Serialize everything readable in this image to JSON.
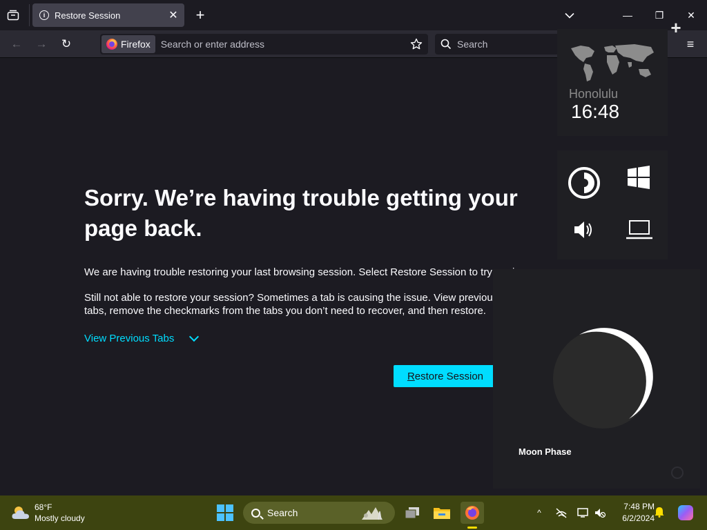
{
  "browser": {
    "tab": {
      "title": "Restore Session",
      "close_glyph": "✕"
    },
    "new_tab_glyph": "+",
    "window_controls": {
      "minimize": "—",
      "restore": "❐",
      "close": "✕",
      "list_all": "⌄"
    },
    "nav": {
      "back": "←",
      "forward": "→",
      "reload": "↻"
    },
    "urlbar": {
      "identity_label": "Firefox",
      "placeholder": "Search or enter address"
    },
    "searchbar": {
      "placeholder": "Search"
    },
    "menu_glyph": "≡"
  },
  "page": {
    "heading": "Sorry. We’re having trouble getting your page back.",
    "paragraph1": "We are having trouble restoring your last browsing session. Select Restore Session to try again.",
    "paragraph2": "Still not able to restore your session? Sometimes a tab is causing the issue. View previous tabs, remove the checkmarks from the tabs you don’t need to recover, and then restore.",
    "view_previous_tabs": "View Previous Tabs",
    "restore_button_accesskey": "R",
    "restore_button_rest": "estore Session"
  },
  "gadgets": {
    "add_glyph": "+",
    "clock": {
      "city": "Honolulu",
      "time": "16:48"
    },
    "moon": {
      "label": "Moon Phase"
    }
  },
  "taskbar": {
    "weather": {
      "temp": "68°F",
      "condition": "Mostly cloudy"
    },
    "search_label": "Search",
    "tray": {
      "time": "7:48 PM",
      "date": "6/2/2024",
      "chevron": "^"
    }
  },
  "colors": {
    "accent": "#00ddff",
    "taskbar": "#3d4410",
    "start": "#4cc2ff"
  }
}
